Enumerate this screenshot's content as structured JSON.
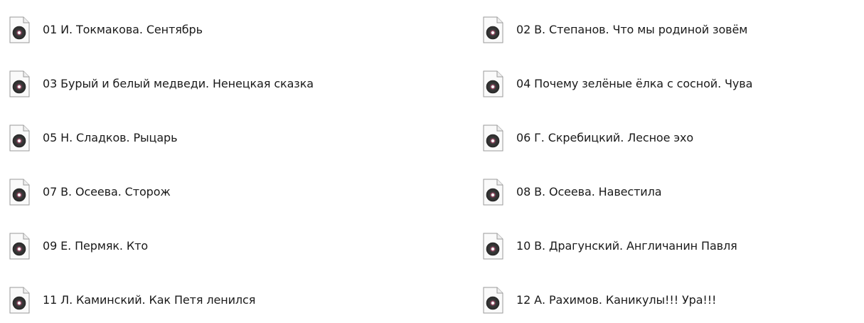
{
  "files": [
    {
      "name": "01 И. Токмакова. Сентябрь",
      "icon": "audio-file-icon"
    },
    {
      "name": "02 В. Степанов. Что мы родиной зовём",
      "icon": "audio-file-icon"
    },
    {
      "name": "03 Бурый и белый медведи. Ненецкая сказка",
      "icon": "audio-file-icon"
    },
    {
      "name": "04 Почему зелёные ёлка с сосной. Чува",
      "icon": "audio-file-icon"
    },
    {
      "name": "05 Н. Сладков. Рыцарь",
      "icon": "audio-file-icon"
    },
    {
      "name": "06 Г. Скребицкий. Лесное эхо",
      "icon": "audio-file-icon"
    },
    {
      "name": "07 В. Осеева. Сторож",
      "icon": "audio-file-icon"
    },
    {
      "name": "08 В. Осеева. Навестила",
      "icon": "audio-file-icon"
    },
    {
      "name": "09 Е. Пермяк. Кто",
      "icon": "audio-file-icon"
    },
    {
      "name": "10 В. Драгунский. Англичанин Павля",
      "icon": "audio-file-icon"
    },
    {
      "name": "11 Л. Каминский. Как Петя ленился",
      "icon": "audio-file-icon"
    },
    {
      "name": "12 А. Рахимов. Каникулы!!! Ура!!!",
      "icon": "audio-file-icon"
    }
  ],
  "colors": {
    "background": "#ffffff",
    "text": "#1a1a1a",
    "disc_dark": "#3b3b3b",
    "disc_accent": "#e0457b"
  }
}
